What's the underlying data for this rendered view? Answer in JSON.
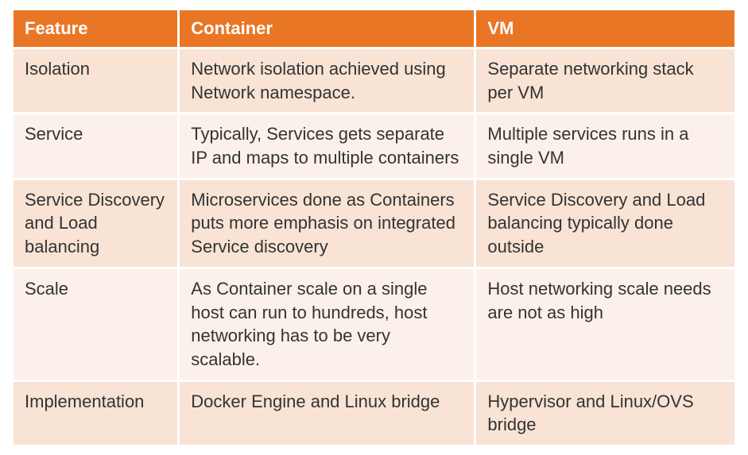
{
  "chart_data": {
    "type": "table",
    "title": "",
    "columns": [
      "Feature",
      "Container",
      "VM"
    ],
    "rows": [
      {
        "feature": "Isolation",
        "container": "Network isolation achieved using Network namespace.",
        "vm": "Separate networking stack per VM"
      },
      {
        "feature": "Service",
        "container": "Typically, Services gets separate IP and maps to multiple containers",
        "vm": "Multiple services runs in a single VM"
      },
      {
        "feature": "Service Discovery and Load balancing",
        "container": "Microservices done as Containers puts more emphasis on integrated Service discovery",
        "vm": "Service Discovery and Load balancing typically done outside"
      },
      {
        "feature": "Scale",
        "container": "As Container scale on a single host can run to hundreds, host networking has to be very scalable.",
        "vm": "Host networking scale needs are not as high"
      },
      {
        "feature": "Implementation",
        "container": "Docker Engine and Linux bridge",
        "vm": "Hypervisor and Linux/OVS bridge"
      }
    ]
  },
  "colors": {
    "header_bg": "#e97625",
    "header_fg": "#ffffff",
    "row_bg": "#f8e3d5",
    "row_alt_bg": "#fcf1ea",
    "text": "#333333"
  }
}
